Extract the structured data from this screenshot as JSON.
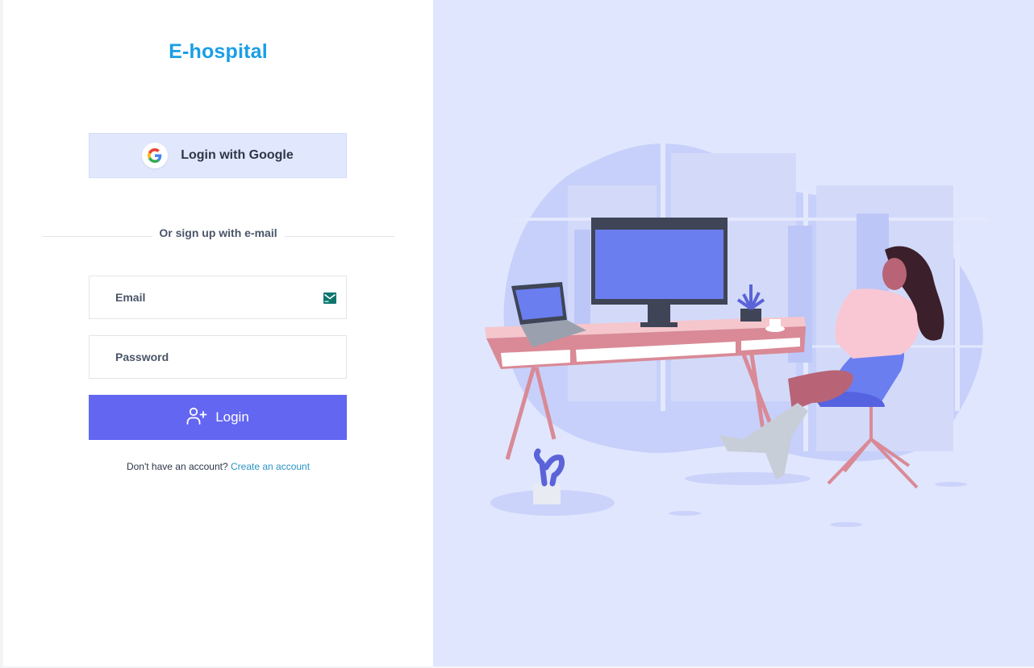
{
  "brand": {
    "title": "E-hospital"
  },
  "google": {
    "label": "Login with Google"
  },
  "divider": {
    "text": "Or sign up with e-mail"
  },
  "form": {
    "email_placeholder": "Email",
    "password_placeholder": "Password",
    "login_label": "Login"
  },
  "signup": {
    "prompt": "Don't have an account?",
    "link": "Create an account"
  },
  "icons": {
    "google": "google-icon",
    "mail": "mail-icon",
    "login": "user-plus-icon"
  },
  "colors": {
    "brand": "#1a9ee6",
    "primary_button": "#6366f1",
    "google_button": "#e1e7fd",
    "illustration_bg": "#e0e6fd",
    "link": "#2a93c7"
  }
}
